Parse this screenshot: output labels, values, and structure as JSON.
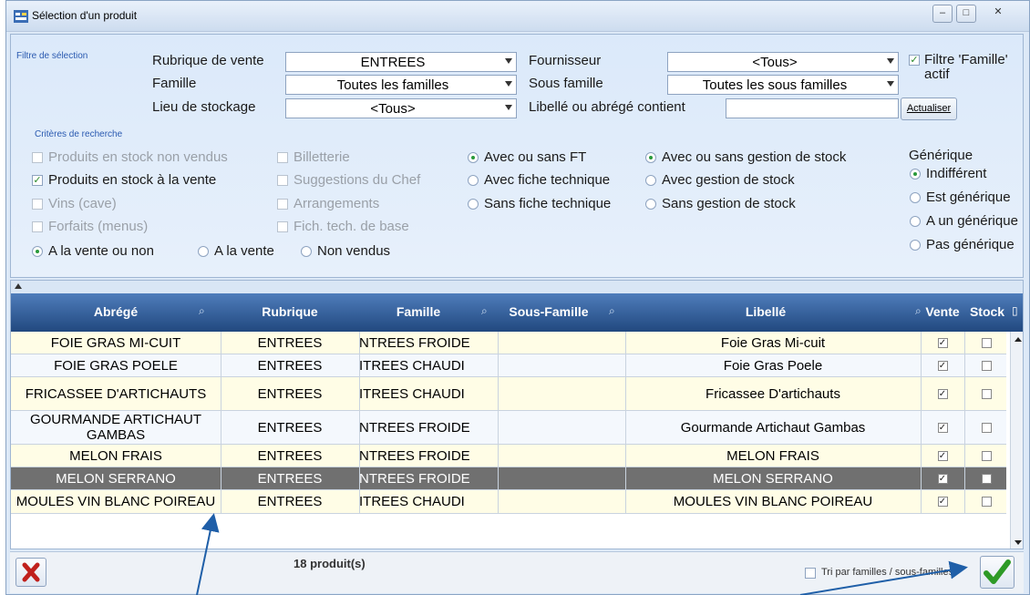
{
  "window": {
    "title": "Sélection d'un produit",
    "buttons": {
      "minimize": "–",
      "maximize": "□",
      "close": "✕"
    }
  },
  "filtre": {
    "section_label": "Filtre de sélection",
    "rubrique_label": "Rubrique de vente",
    "rubrique_value": "ENTREES",
    "famille_label": "Famille",
    "famille_value": "Toutes les familles",
    "lieu_label": "Lieu de stockage",
    "lieu_value": "<Tous>",
    "fournisseur_label": "Fournisseur",
    "fournisseur_value": "<Tous>",
    "sous_famille_label": "Sous famille",
    "sous_famille_value": "Toutes les sous familles",
    "libelle_label": "Libellé ou abrégé contient",
    "libelle_value": "",
    "filtre_famille_label": "Filtre 'Famille' actif",
    "filtre_famille_checked": true,
    "actualiser_label": "Actualiser"
  },
  "criteres": {
    "section_label": "Critères de recherche",
    "checkboxes": [
      {
        "label": "Produits en stock non vendus",
        "checked": false,
        "enabled": false
      },
      {
        "label": "Produits en stock à la vente",
        "checked": true,
        "enabled": true
      },
      {
        "label": "Vins (cave)",
        "checked": false,
        "enabled": false
      },
      {
        "label": "Forfaits (menus)",
        "checked": false,
        "enabled": false
      },
      {
        "label": "Billetterie",
        "checked": false,
        "enabled": false
      },
      {
        "label": "Suggestions du Chef",
        "checked": false,
        "enabled": false
      },
      {
        "label": "Arrangements",
        "checked": false,
        "enabled": false
      },
      {
        "label": "Fich. tech. de base",
        "checked": false,
        "enabled": false
      }
    ],
    "vente_radios": [
      {
        "label": "A la vente ou non",
        "selected": true
      },
      {
        "label": "A la vente",
        "selected": false
      },
      {
        "label": "Non vendus",
        "selected": false
      }
    ],
    "ft_radios": [
      {
        "label": "Avec ou sans FT",
        "selected": true
      },
      {
        "label": "Avec fiche technique",
        "selected": false
      },
      {
        "label": "Sans fiche technique",
        "selected": false
      }
    ],
    "stock_radios": [
      {
        "label": "Avec ou sans gestion de stock",
        "selected": true
      },
      {
        "label": "Avec gestion de stock",
        "selected": false
      },
      {
        "label": "Sans gestion de stock",
        "selected": false
      }
    ],
    "generique_label": "Générique",
    "generique_radios": [
      {
        "label": "Indifférent",
        "selected": true
      },
      {
        "label": "Est générique",
        "selected": false
      },
      {
        "label": "A un générique",
        "selected": false
      },
      {
        "label": "Pas générique",
        "selected": false
      }
    ]
  },
  "table": {
    "columns": [
      "Abrégé",
      "Rubrique",
      "Famille",
      "Sous-Famille",
      "Libellé",
      "Vente",
      "Stock"
    ],
    "rows": [
      {
        "abrege": "FOIE GRAS MI-CUIT",
        "rubrique": "ENTREES",
        "famille": "NTREES FROIDE",
        "sous_famille": "",
        "libelle": "Foie Gras Mi-cuit",
        "vente": true,
        "stock": false
      },
      {
        "abrege": "FOIE GRAS POELE",
        "rubrique": "ENTREES",
        "famille": "ITREES CHAUDI",
        "sous_famille": "",
        "libelle": "Foie Gras Poele",
        "vente": true,
        "stock": false
      },
      {
        "abrege": "FRICASSEE D'ARTICHAUTS",
        "rubrique": "ENTREES",
        "famille": "ITREES CHAUDI",
        "sous_famille": "",
        "libelle": "Fricassee D'artichauts",
        "vente": true,
        "stock": false
      },
      {
        "abrege": "GOURMANDE ARTICHAUT GAMBAS",
        "rubrique": "ENTREES",
        "famille": "NTREES FROIDE",
        "sous_famille": "",
        "libelle": "Gourmande Artichaut Gambas",
        "vente": true,
        "stock": false
      },
      {
        "abrege": "MELON FRAIS",
        "rubrique": "ENTREES",
        "famille": "NTREES FROIDE",
        "sous_famille": "",
        "libelle": "MELON FRAIS",
        "vente": true,
        "stock": false
      },
      {
        "abrege": "MELON SERRANO",
        "rubrique": "ENTREES",
        "famille": "NTREES FROIDE",
        "sous_famille": "",
        "libelle": "MELON SERRANO",
        "vente": true,
        "stock": false
      },
      {
        "abrege": "MOULES VIN BLANC POIREAU",
        "rubrique": "ENTREES",
        "famille": "ITREES CHAUDI",
        "sous_famille": "",
        "libelle": "MOULES VIN BLANC POIREAU",
        "vente": true,
        "stock": false
      }
    ],
    "selected_row": 5
  },
  "footer": {
    "count": "18 produit(s)",
    "tri_label": "Tri par familles / sous-familles",
    "tri_checked": false
  }
}
